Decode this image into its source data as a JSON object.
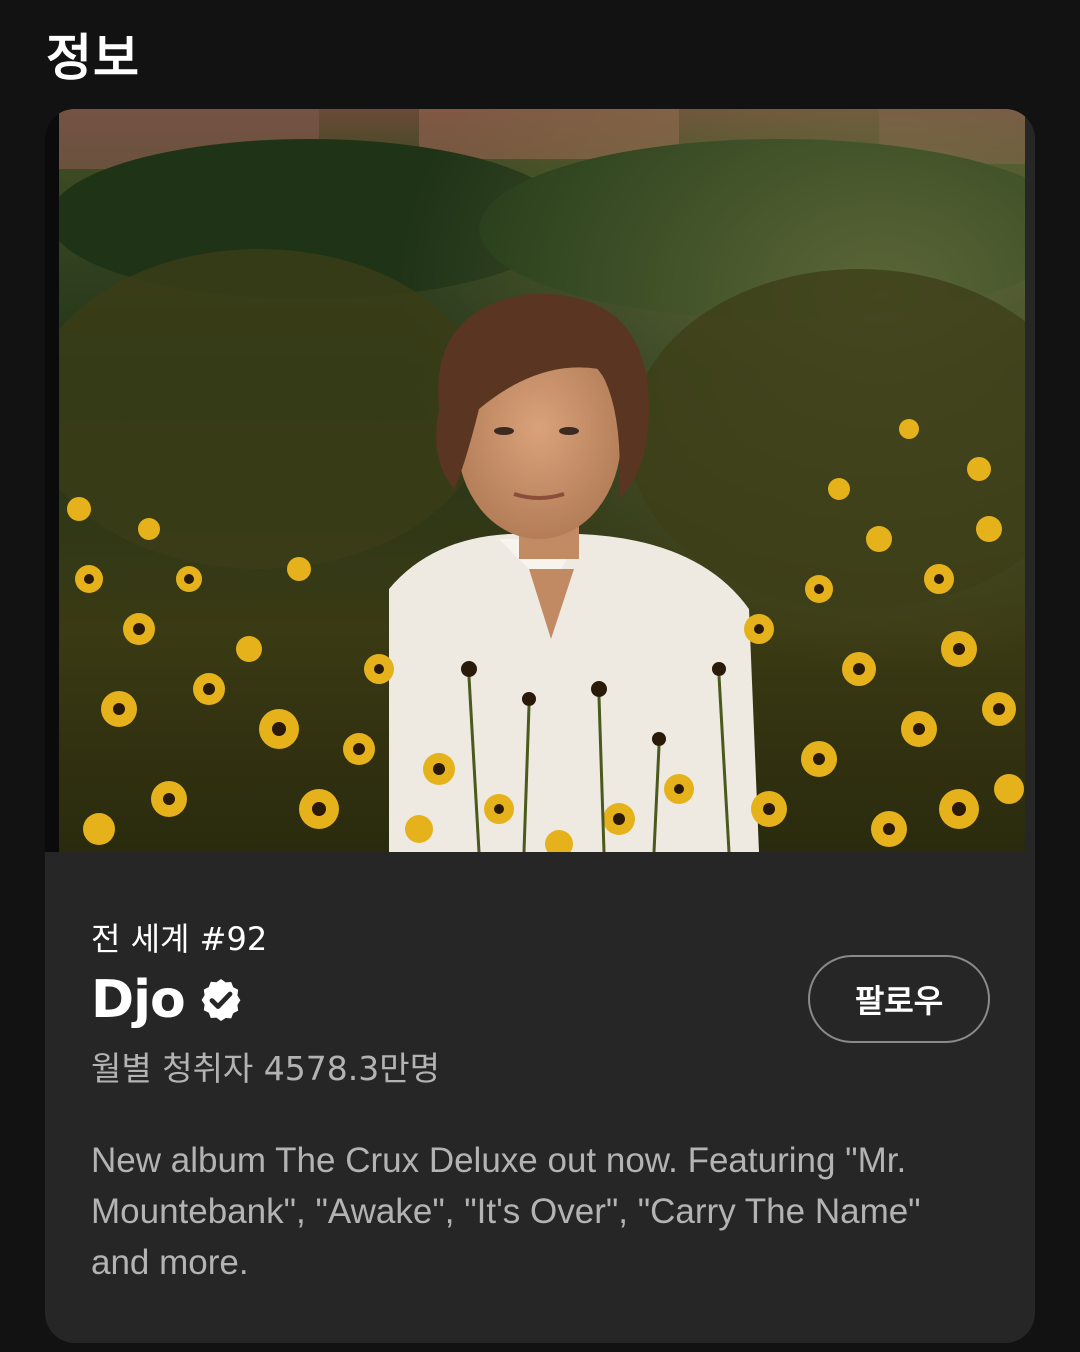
{
  "header": {
    "title": "정보"
  },
  "artist_card": {
    "photo_icon": "artist-photo",
    "rank_label": "전 세계 #92",
    "artist_name": "Djo",
    "verified_icon": "verified-badge-icon",
    "monthly_listeners": "월별 청취자 4578.3만명",
    "follow_label": "팔로우",
    "bio": "New album The Crux Deluxe out now. Featuring \"Mr. Mountebank\", \"Awake\", \"It's Over\", \"Carry The Name\" and more."
  },
  "colors": {
    "background": "#121212",
    "card": "#262626",
    "text_primary": "#ffffff",
    "text_secondary": "#b3b3b3",
    "button_border": "#8a8a8a"
  }
}
